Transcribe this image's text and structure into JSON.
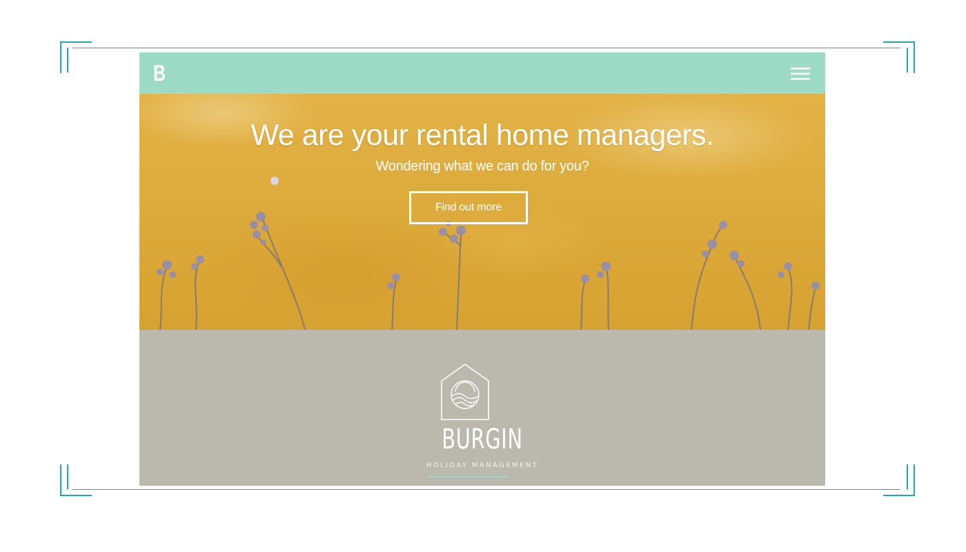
{
  "colors": {
    "accent": "#9ddbc6",
    "frame": "#1fa5b5",
    "hero_base": "#dcaa3a",
    "brand_bg": "#bbb8ad",
    "text_light": "#ffffff"
  },
  "header": {
    "logo_letter": "B",
    "menu_icon": "hamburger-menu-icon"
  },
  "hero": {
    "title": "We are your rental home managers.",
    "subtitle": "Wondering what we can do for you?",
    "cta_label": "Find out more"
  },
  "brand": {
    "logo_icon": "house-waves-icon",
    "name": "BURGIN",
    "tagline": "HOLIDAY MANAGEMENT"
  }
}
